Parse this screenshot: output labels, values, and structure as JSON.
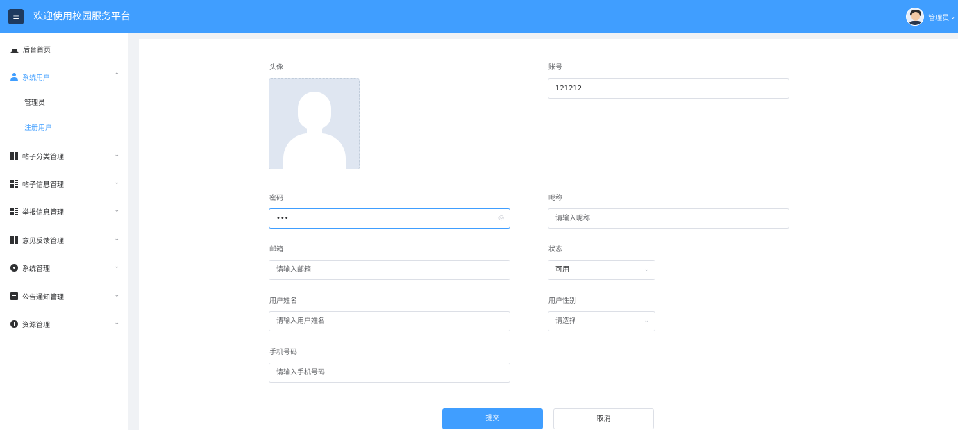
{
  "header": {
    "title": "欢迎使用校园服务平台",
    "menu_icon": "menu-icon",
    "user_name": "管理员",
    "caret": "⌄"
  },
  "sidebar": {
    "items": [
      {
        "label": "后台首页",
        "icon": "home-icon"
      },
      {
        "label": "系统用户",
        "icon": "user-icon",
        "expanded": true
      },
      {
        "label": "帖子分类管理",
        "icon": "grid-icon"
      },
      {
        "label": "帖子信息管理",
        "icon": "grid-icon"
      },
      {
        "label": "举报信息管理",
        "icon": "grid-icon"
      },
      {
        "label": "意见反馈管理",
        "icon": "grid-icon"
      },
      {
        "label": "系统管理",
        "icon": "gear-icon"
      },
      {
        "label": "公告通知管理",
        "icon": "document-icon"
      },
      {
        "label": "资源管理",
        "icon": "plus-circle-icon"
      }
    ],
    "subitems": [
      {
        "label": "管理员"
      },
      {
        "label": "注册用户",
        "active": true
      }
    ],
    "arrow_up": "^",
    "arrow_down": "⌄"
  },
  "form": {
    "avatar_label": "头像",
    "account_label": "账号",
    "account_value": "121212",
    "password_label": "密码",
    "password_value": "•••",
    "nickname_label": "昵称",
    "nickname_placeholder": "请输入昵称",
    "email_label": "邮箱",
    "email_placeholder": "请输入邮箱",
    "status_label": "状态",
    "status_value": "可用",
    "realname_label": "用户姓名",
    "realname_placeholder": "请输入用户姓名",
    "gender_label": "用户性别",
    "gender_placeholder": "请选择",
    "phone_label": "手机号码",
    "phone_placeholder": "请输入手机号码",
    "eye_icon": "◎",
    "select_arrow": "⌄"
  },
  "buttons": {
    "submit": "提交",
    "cancel": "取消"
  },
  "colors": {
    "primary": "#409eff",
    "header_bg": "#409eff",
    "active_text": "#409eff"
  }
}
